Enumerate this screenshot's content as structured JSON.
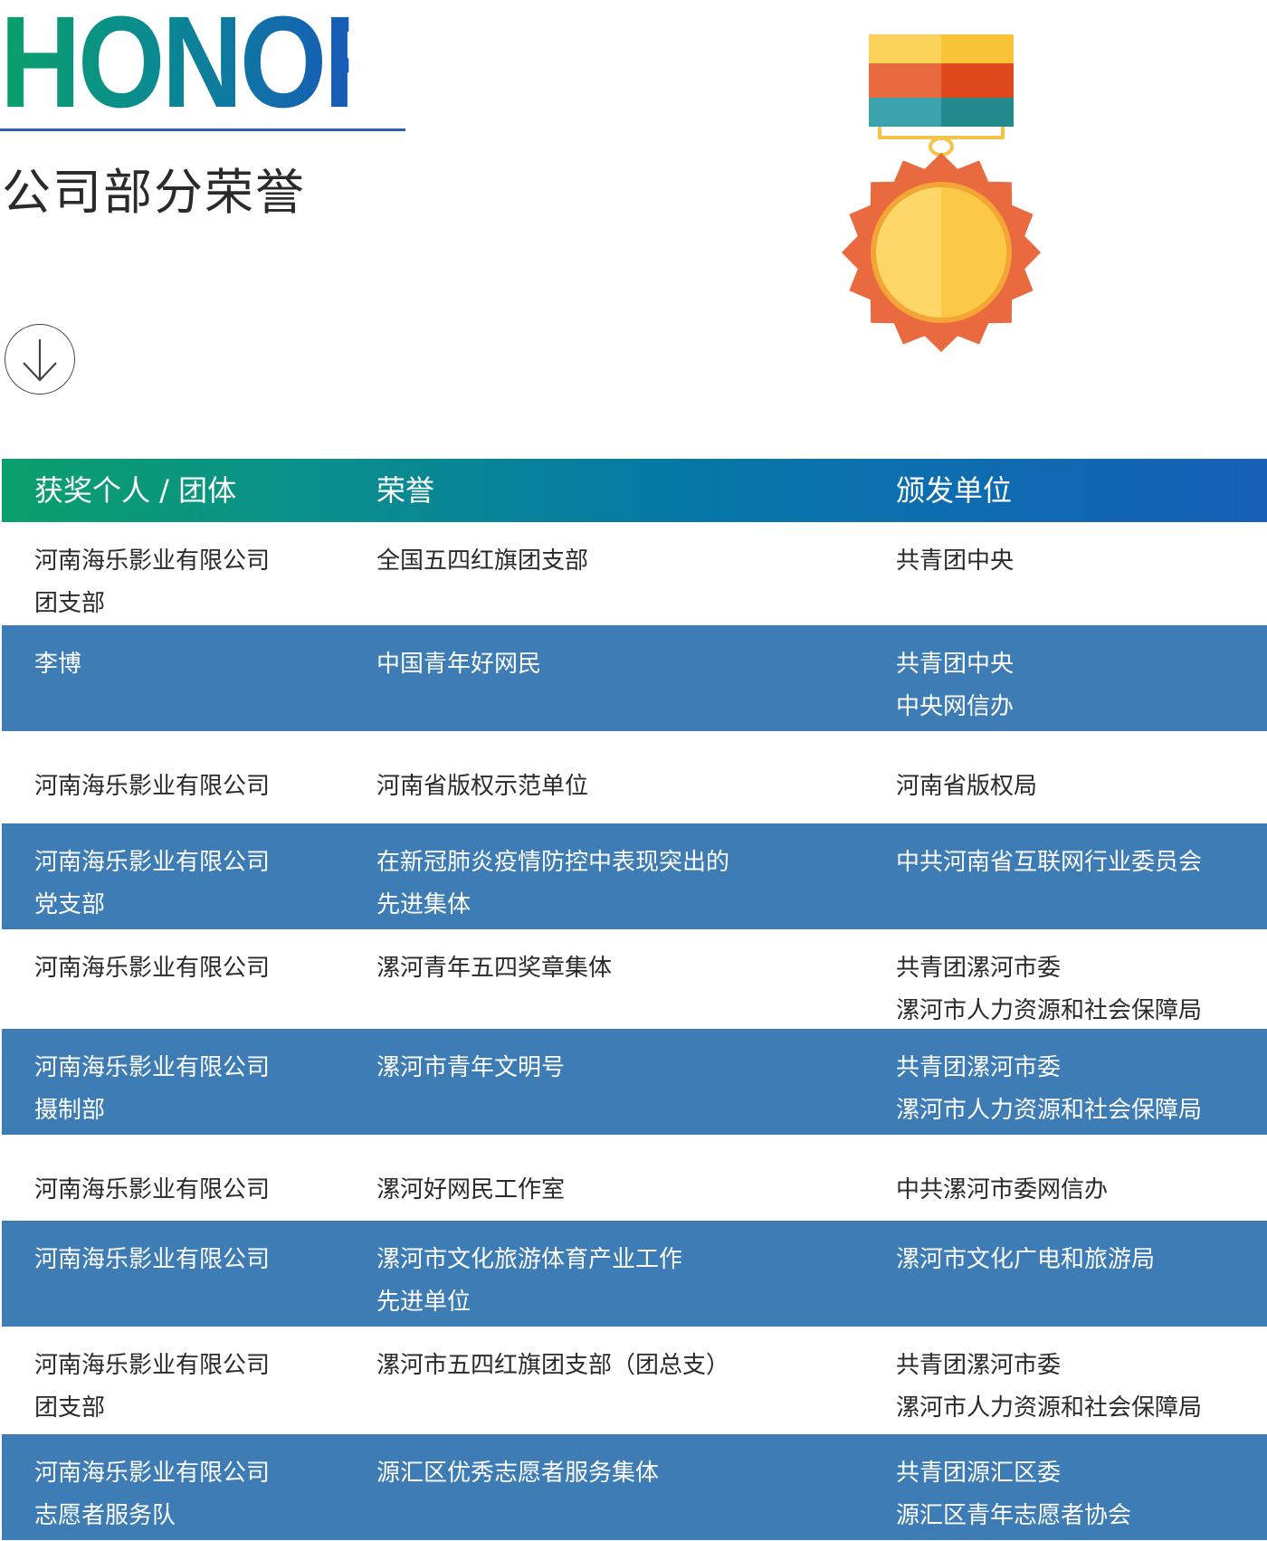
{
  "header": {
    "title": "HONORS",
    "subtitle": "公司部分荣誉"
  },
  "colors": {
    "row_blue": "#3e7cb6",
    "gradient_start": "#0aa06a",
    "gradient_end": "#1760b9"
  },
  "icons": {
    "scroll": "arrow-down-circle-icon",
    "medal": "medal-icon"
  },
  "table": {
    "headers": [
      "获奖个人 / 团体",
      "荣誉",
      "颁发单位"
    ],
    "rows": [
      {
        "recipient": [
          "河南海乐影业有限公司",
          "团支部"
        ],
        "honor": [
          "全国五四红旗团支部"
        ],
        "issuer": [
          "共青团中央"
        ]
      },
      {
        "recipient": [
          "李博"
        ],
        "honor": [
          "中国青年好网民"
        ],
        "issuer": [
          "共青团中央",
          "中央网信办"
        ]
      },
      {
        "recipient": [
          "河南海乐影业有限公司"
        ],
        "honor": [
          "河南省版权示范单位"
        ],
        "issuer": [
          "河南省版权局"
        ]
      },
      {
        "recipient": [
          "河南海乐影业有限公司",
          "党支部"
        ],
        "honor": [
          "在新冠肺炎疫情防控中表现突出的",
          "先进集体"
        ],
        "issuer": [
          "中共河南省互联网行业委员会"
        ]
      },
      {
        "recipient": [
          "河南海乐影业有限公司"
        ],
        "honor": [
          "漯河青年五四奖章集体"
        ],
        "issuer": [
          "共青团漯河市委",
          "漯河市人力资源和社会保障局"
        ]
      },
      {
        "recipient": [
          "河南海乐影业有限公司",
          "摄制部"
        ],
        "honor": [
          "漯河市青年文明号"
        ],
        "issuer": [
          "共青团漯河市委",
          "漯河市人力资源和社会保障局"
        ]
      },
      {
        "recipient": [
          "河南海乐影业有限公司"
        ],
        "honor": [
          "漯河好网民工作室"
        ],
        "issuer": [
          "中共漯河市委网信办"
        ]
      },
      {
        "recipient": [
          "河南海乐影业有限公司"
        ],
        "honor": [
          "漯河市文化旅游体育产业工作",
          "先进单位"
        ],
        "issuer": [
          "漯河市文化广电和旅游局"
        ]
      },
      {
        "recipient": [
          "河南海乐影业有限公司",
          "团支部"
        ],
        "honor": [
          "漯河市五四红旗团支部（团总支）"
        ],
        "issuer": [
          "共青团漯河市委",
          "漯河市人力资源和社会保障局"
        ]
      },
      {
        "recipient": [
          "河南海乐影业有限公司",
          "志愿者服务队"
        ],
        "honor": [
          "源汇区优秀志愿者服务集体"
        ],
        "issuer": [
          "共青团源汇区委",
          "源汇区青年志愿者协会"
        ]
      }
    ]
  }
}
